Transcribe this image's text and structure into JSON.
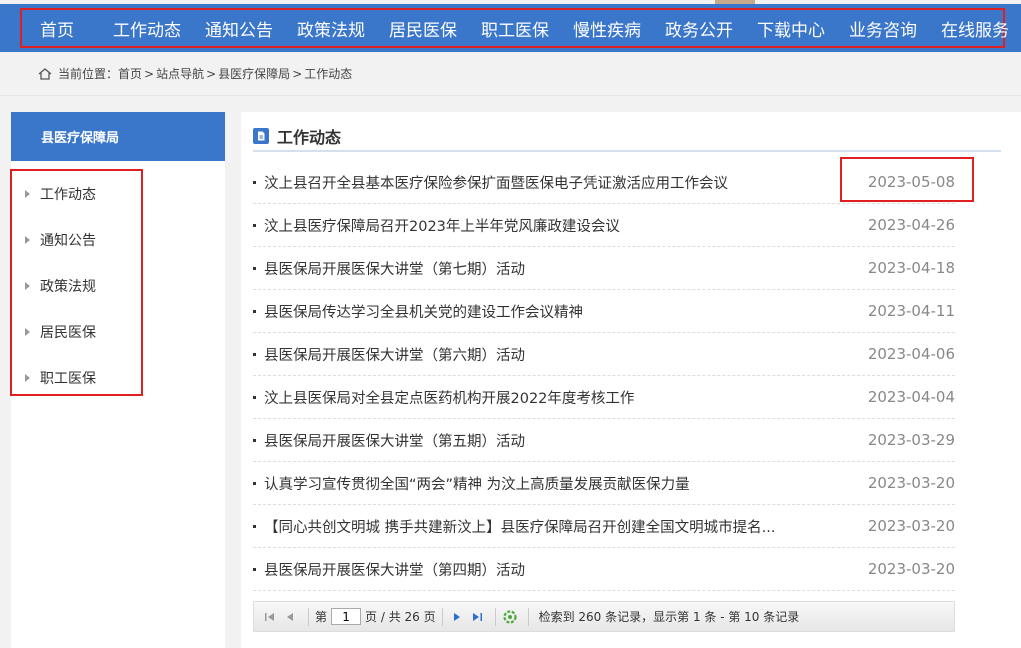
{
  "nav": {
    "items": [
      "首页",
      "工作动态",
      "通知公告",
      "政策法规",
      "居民医保",
      "职工医保",
      "慢性疾病",
      "政务公开",
      "下载中心",
      "业务咨询",
      "在线服务"
    ]
  },
  "breadcrumb": {
    "prefix": "当前位置：",
    "items": [
      "首页",
      "站点导航",
      "县医疗保障局",
      "工作动态"
    ],
    "sep": ">"
  },
  "sidebar": {
    "title": "县医疗保障局",
    "items": [
      "工作动态",
      "通知公告",
      "政策法规",
      "居民医保",
      "职工医保"
    ]
  },
  "main": {
    "title": "工作动态",
    "news": [
      {
        "title": "汶上县召开全县基本医疗保险参保扩面暨医保电子凭证激活应用工作会议",
        "date": "2023-05-08"
      },
      {
        "title": "汶上县医疗保障局召开2023年上半年党风廉政建设会议",
        "date": "2023-04-26"
      },
      {
        "title": "县医保局开展医保大讲堂（第七期）活动",
        "date": "2023-04-18"
      },
      {
        "title": "县医保局传达学习全县机关党的建设工作会议精神",
        "date": "2023-04-11"
      },
      {
        "title": "县医保局开展医保大讲堂（第六期）活动",
        "date": "2023-04-06"
      },
      {
        "title": "汶上县医保局对全县定点医药机构开展2022年度考核工作",
        "date": "2023-04-04"
      },
      {
        "title": "县医保局开展医保大讲堂（第五期）活动",
        "date": "2023-03-29"
      },
      {
        "title": "认真学习宣传贯彻全国“两会”精神 为汶上高质量发展贡献医保力量",
        "date": "2023-03-20"
      },
      {
        "title": "【同心共创文明城 携手共建新汶上】县医疗保障局召开创建全国文明城市提名...",
        "date": "2023-03-20"
      },
      {
        "title": "县医保局开展医保大讲堂（第四期）活动",
        "date": "2023-03-20"
      }
    ]
  },
  "pager": {
    "page_label": "第",
    "current_page": "1",
    "page_suffix": "页 / 共 26 页",
    "info": "检索到 260 条记录，显示第 1 条 - 第 10 条记录"
  },
  "colors": {
    "nav_bg": "#3a76c9",
    "highlight": "#e02020"
  }
}
